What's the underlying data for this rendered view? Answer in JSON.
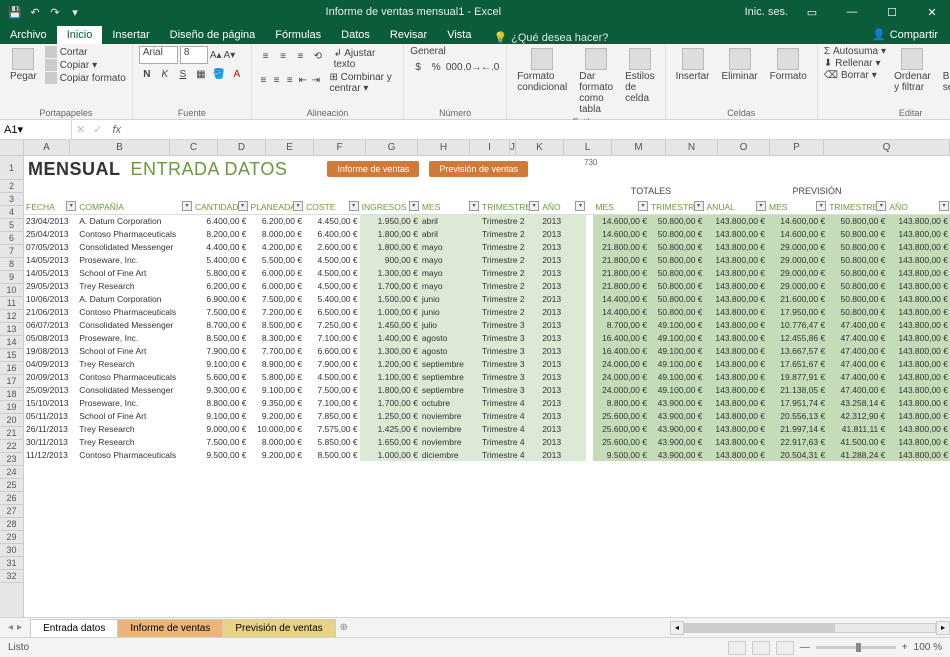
{
  "titlebar": {
    "title": "Informe de ventas mensual1 - Excel",
    "signin": "Inic. ses."
  },
  "menu": {
    "file": "Archivo",
    "home": "Inicio",
    "insert": "Insertar",
    "layout": "Diseño de página",
    "formulas": "Fórmulas",
    "data": "Datos",
    "review": "Revisar",
    "view": "Vista",
    "tellme": "¿Qué desea hacer?",
    "share": "Compartir"
  },
  "ribbon": {
    "paste": "Pegar",
    "cut": "Cortar",
    "copy": "Copiar",
    "format_painter": "Copiar formato",
    "clipboard": "Portapapeles",
    "font_name": "Arial",
    "font_size": "8",
    "font_group": "Fuente",
    "wrap": "Ajustar texto",
    "merge": "Combinar y centrar",
    "align_group": "Alineación",
    "numfmt": "General",
    "num_group": "Número",
    "cond": "Formato condicional",
    "table": "Dar formato como tabla",
    "cellsty": "Estilos de celda",
    "styles_group": "Estilos",
    "insert_c": "Insertar",
    "delete_c": "Eliminar",
    "format_c": "Formato",
    "cells_group": "Celdas",
    "autosum": "Autosuma",
    "fill": "Rellenar",
    "clear": "Borrar",
    "sort": "Ordenar y filtrar",
    "find": "Buscar y seleccionar",
    "edit_group": "Editar"
  },
  "fx": {
    "cellref": "A1"
  },
  "colheaders": [
    "A",
    "B",
    "C",
    "D",
    "E",
    "F",
    "G",
    "H",
    "I",
    "J",
    "K",
    "L",
    "M",
    "N",
    "O",
    "P",
    "Q"
  ],
  "page_title1": "MENSUAL",
  "page_title2": "ENTRADA DATOS",
  "btn1": "Informe de ventas",
  "btn2": "Previsión de ventas",
  "sect_totales": "TOTALES",
  "sect_prevision": "PREVISIÓN",
  "headers": {
    "fecha": "FECHA",
    "comp": "COMPAÑÍA",
    "cant": "CANTIDAD",
    "plan": "PLANEADA",
    "cost": "COSTE",
    "ing": "INGRESOS",
    "mes": "MES",
    "tri": "TRIMESTRE",
    "ano": "AÑO",
    "anual": "ANUAL"
  },
  "rows": [
    {
      "f": "23/04/2013",
      "c": "A. Datum Corporation",
      "q": "6.400,00 €",
      "p": "6.200,00 €",
      "co": "4.450,00 €",
      "i": "1.950,00 €",
      "m": "abril",
      "t": "Trimestre 2",
      "a": "2013",
      "tm": "14.600,00 €",
      "tt": "50.800,00 €",
      "ta": "143.800,00 €",
      "pm": "14.600,00 €",
      "pt": "50.800,00 €",
      "pa": "143.800,00 €"
    },
    {
      "f": "25/04/2013",
      "c": "Contoso Pharmaceuticals",
      "q": "8.200,00 €",
      "p": "8.000,00 €",
      "co": "6.400,00 €",
      "i": "1.800,00 €",
      "m": "abril",
      "t": "Trimestre 2",
      "a": "2013",
      "tm": "14.600,00 €",
      "tt": "50.800,00 €",
      "ta": "143.800,00 €",
      "pm": "14.600,00 €",
      "pt": "50.800,00 €",
      "pa": "143.800,00 €"
    },
    {
      "f": "07/05/2013",
      "c": "Consolidated Messenger",
      "q": "4.400,00 €",
      "p": "4.200,00 €",
      "co": "2.600,00 €",
      "i": "1.800,00 €",
      "m": "mayo",
      "t": "Trimestre 2",
      "a": "2013",
      "tm": "21.800,00 €",
      "tt": "50.800,00 €",
      "ta": "143.800,00 €",
      "pm": "29.000,00 €",
      "pt": "50.800,00 €",
      "pa": "143.800,00 €"
    },
    {
      "f": "14/05/2013",
      "c": "Proseware, Inc.",
      "q": "5.400,00 €",
      "p": "5.500,00 €",
      "co": "4.500,00 €",
      "i": "900,00 €",
      "m": "mayo",
      "t": "Trimestre 2",
      "a": "2013",
      "tm": "21.800,00 €",
      "tt": "50.800,00 €",
      "ta": "143.800,00 €",
      "pm": "29.000,00 €",
      "pt": "50.800,00 €",
      "pa": "143.800,00 €"
    },
    {
      "f": "14/05/2013",
      "c": "School of Fine Art",
      "q": "5.800,00 €",
      "p": "6.000,00 €",
      "co": "4.500,00 €",
      "i": "1.300,00 €",
      "m": "mayo",
      "t": "Trimestre 2",
      "a": "2013",
      "tm": "21.800,00 €",
      "tt": "50.800,00 €",
      "ta": "143.800,00 €",
      "pm": "29.000,00 €",
      "pt": "50.800,00 €",
      "pa": "143.800,00 €"
    },
    {
      "f": "29/05/2013",
      "c": "Trey Research",
      "q": "6.200,00 €",
      "p": "6.000,00 €",
      "co": "4.500,00 €",
      "i": "1.700,00 €",
      "m": "mayo",
      "t": "Trimestre 2",
      "a": "2013",
      "tm": "21.800,00 €",
      "tt": "50.800,00 €",
      "ta": "143.800,00 €",
      "pm": "29.000,00 €",
      "pt": "50.800,00 €",
      "pa": "143.800,00 €"
    },
    {
      "f": "10/06/2013",
      "c": "A. Datum Corporation",
      "q": "6.900,00 €",
      "p": "7.500,00 €",
      "co": "5.400,00 €",
      "i": "1.500,00 €",
      "m": "junio",
      "t": "Trimestre 2",
      "a": "2013",
      "tm": "14.400,00 €",
      "tt": "50.800,00 €",
      "ta": "143.800,00 €",
      "pm": "21.600,00 €",
      "pt": "50.800,00 €",
      "pa": "143.800,00 €"
    },
    {
      "f": "21/06/2013",
      "c": "Contoso Pharmaceuticals",
      "q": "7.500,00 €",
      "p": "7.200,00 €",
      "co": "6.500,00 €",
      "i": "1.000,00 €",
      "m": "junio",
      "t": "Trimestre 2",
      "a": "2013",
      "tm": "14.400,00 €",
      "tt": "50.800,00 €",
      "ta": "143.800,00 €",
      "pm": "17.950,00 €",
      "pt": "50.800,00 €",
      "pa": "143.800,00 €"
    },
    {
      "f": "06/07/2013",
      "c": "Consolidated Messenger",
      "q": "8.700,00 €",
      "p": "8.500,00 €",
      "co": "7.250,00 €",
      "i": "1.450,00 €",
      "m": "julio",
      "t": "Trimestre 3",
      "a": "2013",
      "tm": "8.700,00 €",
      "tt": "49.100,00 €",
      "ta": "143.800,00 €",
      "pm": "10.776,47 €",
      "pt": "47.400,00 €",
      "pa": "143.800,00 €"
    },
    {
      "f": "05/08/2013",
      "c": "Proseware, Inc.",
      "q": "8.500,00 €",
      "p": "8.300,00 €",
      "co": "7.100,00 €",
      "i": "1.400,00 €",
      "m": "agosto",
      "t": "Trimestre 3",
      "a": "2013",
      "tm": "16.400,00 €",
      "tt": "49.100,00 €",
      "ta": "143.800,00 €",
      "pm": "12.455,86 €",
      "pt": "47.400,00 €",
      "pa": "143.800,00 €"
    },
    {
      "f": "19/08/2013",
      "c": "School of Fine Art",
      "q": "7.900,00 €",
      "p": "7.700,00 €",
      "co": "6.600,00 €",
      "i": "1.300,00 €",
      "m": "agosto",
      "t": "Trimestre 3",
      "a": "2013",
      "tm": "16.400,00 €",
      "tt": "49.100,00 €",
      "ta": "143.800,00 €",
      "pm": "13.667,57 €",
      "pt": "47.400,00 €",
      "pa": "143.800,00 €"
    },
    {
      "f": "04/09/2013",
      "c": "Trey Research",
      "q": "9.100,00 €",
      "p": "8.900,00 €",
      "co": "7.900,00 €",
      "i": "1.200,00 €",
      "m": "septiembre",
      "t": "Trimestre 3",
      "a": "2013",
      "tm": "24.000,00 €",
      "tt": "49.100,00 €",
      "ta": "143.800,00 €",
      "pm": "17.651,67 €",
      "pt": "47.400,00 €",
      "pa": "143.800,00 €"
    },
    {
      "f": "20/09/2013",
      "c": "Contoso Pharmaceuticals",
      "q": "5.600,00 €",
      "p": "5.800,00 €",
      "co": "4.500,00 €",
      "i": "1.100,00 €",
      "m": "septiembre",
      "t": "Trimestre 3",
      "a": "2013",
      "tm": "24.000,00 €",
      "tt": "49.100,00 €",
      "ta": "143.800,00 €",
      "pm": "19.877,91 €",
      "pt": "47.400,00 €",
      "pa": "143.800,00 €"
    },
    {
      "f": "25/09/2013",
      "c": "Consolidated Messenger",
      "q": "9.300,00 €",
      "p": "9.100,00 €",
      "co": "7.500,00 €",
      "i": "1.800,00 €",
      "m": "septiembre",
      "t": "Trimestre 3",
      "a": "2013",
      "tm": "24.000,00 €",
      "tt": "49.100,00 €",
      "ta": "143.800,00 €",
      "pm": "21.138,05 €",
      "pt": "47.400,00 €",
      "pa": "143.800,00 €"
    },
    {
      "f": "15/10/2013",
      "c": "Proseware, Inc.",
      "q": "8.800,00 €",
      "p": "9.350,00 €",
      "co": "7.100,00 €",
      "i": "1.700,00 €",
      "m": "octubre",
      "t": "Trimestre 4",
      "a": "2013",
      "tm": "8.800,00 €",
      "tt": "43.900,00 €",
      "ta": "143.800,00 €",
      "pm": "17.951,74 €",
      "pt": "43.258,14 €",
      "pa": "143.800,00 €"
    },
    {
      "f": "05/11/2013",
      "c": "School of Fine Art",
      "q": "9.100,00 €",
      "p": "9.200,00 €",
      "co": "7.850,00 €",
      "i": "1.250,00 €",
      "m": "noviembre",
      "t": "Trimestre 4",
      "a": "2013",
      "tm": "25.600,00 €",
      "tt": "43.900,00 €",
      "ta": "143.800,00 €",
      "pm": "20.556,13 €",
      "pt": "42.312,90 €",
      "pa": "143.800,00 €"
    },
    {
      "f": "26/11/2013",
      "c": "Trey Research",
      "q": "9.000,00 €",
      "p": "10.000,00 €",
      "co": "7.575,00 €",
      "i": "1.425,00 €",
      "m": "noviembre",
      "t": "Trimestre 4",
      "a": "2013",
      "tm": "25.600,00 €",
      "tt": "43.900,00 €",
      "ta": "143.800,00 €",
      "pm": "21.997,14 €",
      "pt": "41.811,11 €",
      "pa": "143.800,00 €"
    },
    {
      "f": "30/11/2013",
      "c": "Trey Research",
      "q": "7.500,00 €",
      "p": "8.000,00 €",
      "co": "5.850,00 €",
      "i": "1.650,00 €",
      "m": "noviembre",
      "t": "Trimestre 4",
      "a": "2013",
      "tm": "25.600,00 €",
      "tt": "43.900,00 €",
      "ta": "143.800,00 €",
      "pm": "22.917,63 €",
      "pt": "41.500,00 €",
      "pa": "143.800,00 €"
    },
    {
      "f": "11/12/2013",
      "c": "Contoso Pharmaceuticals",
      "q": "9.500,00 €",
      "p": "9.200,00 €",
      "co": "8.500,00 €",
      "i": "1.000,00 €",
      "m": "diciembre",
      "t": "Trimestre 4",
      "a": "2013",
      "tm": "9.500,00 €",
      "tt": "43.900,00 €",
      "ta": "143.800,00 €",
      "pm": "20.504,31 €",
      "pt": "41.288,24 €",
      "pa": "143.800,00 €"
    }
  ],
  "tabs": {
    "t1": "Entrada datos",
    "t2": "Informe de ventas",
    "t3": "Previsión de ventas"
  },
  "status": {
    "ready": "Listo",
    "zoom": "100 %"
  },
  "misc": {
    "seven_thirty": "730"
  }
}
